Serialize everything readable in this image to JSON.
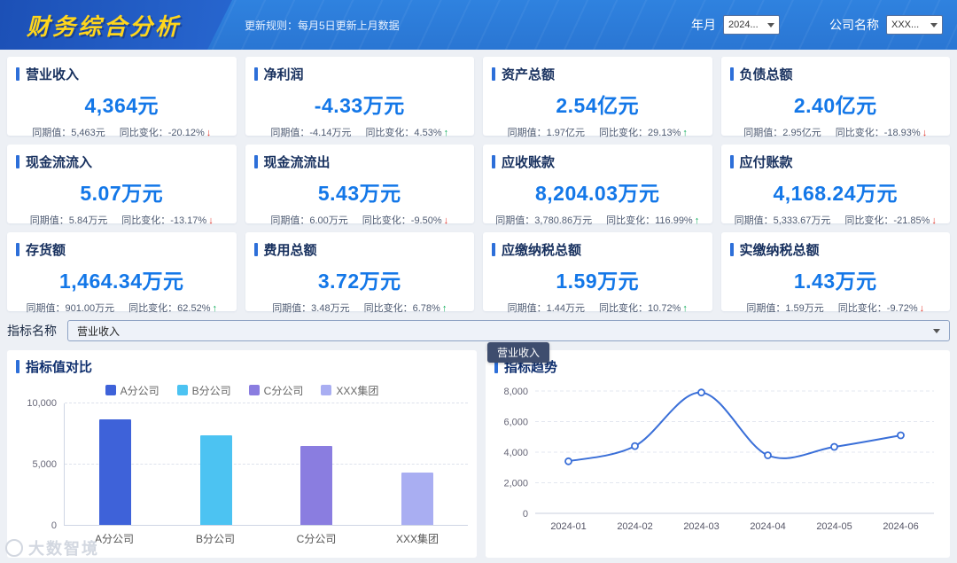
{
  "header": {
    "title": "财务综合分析",
    "update_rule": "更新规则：每月5日更新上月数据",
    "year_month_label": "年月",
    "year_month_value": "2024...",
    "company_label": "公司名称",
    "company_value": "XXX..."
  },
  "kpi_cards": [
    {
      "title": "营业收入",
      "value": "4,364元",
      "prev": "同期值：5,463元",
      "change": "同比变化：-20.12%",
      "trend": "down"
    },
    {
      "title": "净利润",
      "value": "-4.33万元",
      "prev": "同期值：-4.14万元",
      "change": "同比变化：4.53%",
      "trend": "up"
    },
    {
      "title": "资产总额",
      "value": "2.54亿元",
      "prev": "同期值：1.97亿元",
      "change": "同比变化：29.13%",
      "trend": "up"
    },
    {
      "title": "负债总额",
      "value": "2.40亿元",
      "prev": "同期值：2.95亿元",
      "change": "同比变化：-18.93%",
      "trend": "down"
    },
    {
      "title": "现金流流入",
      "value": "5.07万元",
      "prev": "同期值：5.84万元",
      "change": "同比变化：-13.17%",
      "trend": "down"
    },
    {
      "title": "现金流流出",
      "value": "5.43万元",
      "prev": "同期值：6.00万元",
      "change": "同比变化：-9.50%",
      "trend": "down"
    },
    {
      "title": "应收账款",
      "value": "8,204.03万元",
      "prev": "同期值：3,780.86万元",
      "change": "同比变化：116.99%",
      "trend": "up"
    },
    {
      "title": "应付账款",
      "value": "4,168.24万元",
      "prev": "同期值：5,333.67万元",
      "change": "同比变化：-21.85%",
      "trend": "down"
    },
    {
      "title": "存货额",
      "value": "1,464.34万元",
      "prev": "同期值：901.00万元",
      "change": "同比变化：62.52%",
      "trend": "up"
    },
    {
      "title": "费用总额",
      "value": "3.72万元",
      "prev": "同期值：3.48万元",
      "change": "同比变化：6.78%",
      "trend": "up"
    },
    {
      "title": "应缴纳税总额",
      "value": "1.59万元",
      "prev": "同期值：1.44万元",
      "change": "同比变化：10.72%",
      "trend": "up"
    },
    {
      "title": "实缴纳税总额",
      "value": "1.43万元",
      "prev": "同期值：1.59万元",
      "change": "同比变化：-9.72%",
      "trend": "down"
    }
  ],
  "indicator": {
    "label": "指标名称",
    "value": "营业收入"
  },
  "panels": {
    "compare_title": "指标值对比",
    "trend_title": "指标趋势",
    "trend_tooltip": "营业收入"
  },
  "watermark": {
    "text": "大数智境"
  },
  "colors": {
    "accent": "#2d6fd9",
    "value_blue": "#1377e8",
    "up_green": "#0caa58",
    "down_red": "#e3372c",
    "header_blue": "#2a76d3",
    "title_yellow": "#ffd61c"
  },
  "chart_data": [
    {
      "type": "bar",
      "title": "指标值对比",
      "categories": [
        "A分公司",
        "B分公司",
        "C分公司",
        "XXX集团"
      ],
      "values": [
        8700,
        7400,
        6500,
        4300
      ],
      "colors": [
        "#3e62d9",
        "#4cc3f2",
        "#8a7de0",
        "#a9aef2"
      ],
      "ylim": [
        0,
        10000
      ],
      "yticks": [
        0,
        5000,
        10000
      ],
      "legend_position": "top",
      "grid": true
    },
    {
      "type": "line",
      "title": "指标趋势",
      "x": [
        "2024-01",
        "2024-02",
        "2024-03",
        "2024-04",
        "2024-05",
        "2024-06"
      ],
      "values": [
        3400,
        4400,
        7900,
        3800,
        4350,
        5100
      ],
      "ylim": [
        0,
        8000
      ],
      "yticks": [
        0,
        2000,
        4000,
        6000,
        8000
      ],
      "color": "#3a6fd8",
      "smooth": true,
      "grid": true
    }
  ]
}
